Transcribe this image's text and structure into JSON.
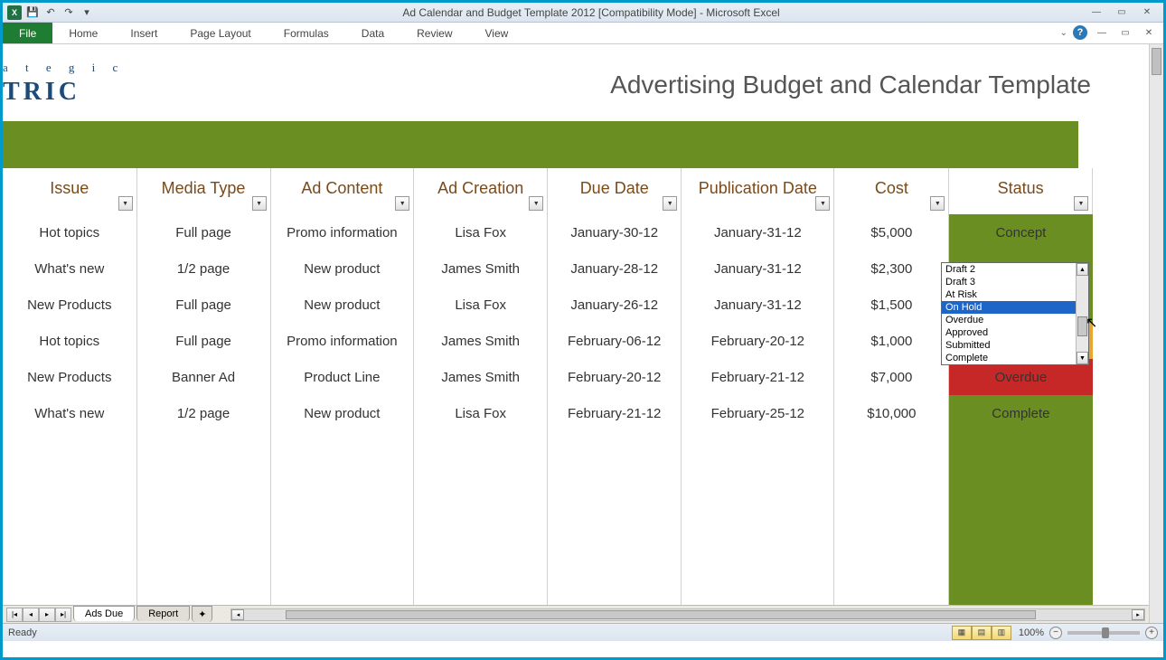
{
  "window": {
    "title": "Ad Calendar and Budget Template 2012  [Compatibility Mode]  -  Microsoft Excel"
  },
  "ribbon": {
    "file": "File",
    "tabs": [
      "Home",
      "Insert",
      "Page Layout",
      "Formulas",
      "Data",
      "Review",
      "View"
    ]
  },
  "logo": {
    "line1": "a t e g i c",
    "line2": "TRIC"
  },
  "page_title": "Advertising Budget and Calendar Template",
  "headers": [
    "Issue",
    "Media Type",
    "Ad Content",
    "Ad Creation",
    "Due Date",
    "Publication Date",
    "Cost",
    "Status"
  ],
  "rows": [
    {
      "issue": "Hot topics",
      "media": "Full page",
      "content": "Promo information",
      "creation": "Lisa Fox",
      "due": "January-30-12",
      "pub": "January-31-12",
      "cost": "$5,000",
      "status": "Concept",
      "status_class": "status-concept"
    },
    {
      "issue": "What's new",
      "media": "1/2 page",
      "content": "New product",
      "creation": "James Smith",
      "due": "January-28-12",
      "pub": "January-31-12",
      "cost": "$2,300",
      "status": "",
      "status_class": "status-empty"
    },
    {
      "issue": "New Products",
      "media": "Full page",
      "content": "New product",
      "creation": "Lisa Fox",
      "due": "January-26-12",
      "pub": "January-31-12",
      "cost": "$1,500",
      "status": "",
      "status_class": "status-empty"
    },
    {
      "issue": "Hot topics",
      "media": "Full page",
      "content": "Promo information",
      "creation": "James Smith",
      "due": "February-06-12",
      "pub": "February-20-12",
      "cost": "$1,000",
      "status": "",
      "status_class": "partial-orange"
    },
    {
      "issue": "New Products",
      "media": "Banner Ad",
      "content": "Product Line",
      "creation": "James Smith",
      "due": "February-20-12",
      "pub": "February-21-12",
      "cost": "$7,000",
      "status": "Overdue",
      "status_class": "status-overdue"
    },
    {
      "issue": "What's new",
      "media": "1/2 page",
      "content": "New product",
      "creation": "Lisa Fox",
      "due": "February-21-12",
      "pub": "February-25-12",
      "cost": "$10,000",
      "status": "Complete",
      "status_class": "status-complete"
    }
  ],
  "dropdown": {
    "items": [
      "Draft 2",
      "Draft 3",
      "At Risk",
      "On Hold",
      "Overdue",
      "Approved",
      "Submitted",
      "Complete"
    ],
    "selected": "On Hold"
  },
  "sheet_tabs": {
    "active": "Ads Due",
    "others": [
      "Report"
    ]
  },
  "statusbar": {
    "ready": "Ready",
    "zoom": "100%"
  }
}
